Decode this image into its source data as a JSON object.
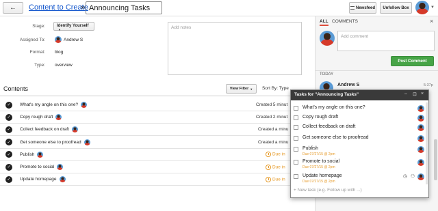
{
  "toolbar": {
    "back_glyph": "←",
    "breadcrumb": "Content to Create",
    "separator": "»",
    "title": "Announcing Tasks",
    "newsfeed_label": "Newsfeed",
    "unfollow_label": "Unfollow Box"
  },
  "meta": {
    "stage_label": "Stage:",
    "stage_value": "Identify Yourself",
    "assigned_label": "Assigned To:",
    "assigned_value": "Andrew S",
    "format_label": "Format:",
    "format_value": "blog",
    "type_label": "Type:",
    "type_value": "overview",
    "notes_placeholder": "Add notes"
  },
  "contents": {
    "title": "Contents",
    "view_filter": "View Filter",
    "sort_by": "Sort By: Type",
    "rows": [
      {
        "label": "What's my angle on this one?",
        "status": "Created 5 minut",
        "due": false
      },
      {
        "label": "Copy rough draft",
        "status": "Created 2 minut",
        "due": false
      },
      {
        "label": "Collect feedback on draft",
        "status": "Created a minu",
        "due": false
      },
      {
        "label": "Get someone else to proofread",
        "status": "Created a minu",
        "due": false
      },
      {
        "label": "Publish",
        "status": "Due in",
        "due": true
      },
      {
        "label": "Promote to social",
        "status": "Due in",
        "due": true
      },
      {
        "label": "Update homepage",
        "status": "Due in",
        "due": true
      }
    ]
  },
  "side": {
    "tab_all": "ALL",
    "tab_comments": "COMMENTS",
    "close_glyph": "×",
    "comment_placeholder": "Add comment",
    "post_button": "Post Comment",
    "today_label": "TODAY",
    "feed_name": "Andrew S",
    "feed_time": "5:37p"
  },
  "task_panel": {
    "title": "Tasks for \"Announcing Tasks\"",
    "controls": [
      "–",
      "⊡",
      "×"
    ],
    "tasks": [
      {
        "label": "What's my angle on this one?",
        "due": ""
      },
      {
        "label": "Copy rough draft",
        "due": ""
      },
      {
        "label": "Collect feedback on draft",
        "due": ""
      },
      {
        "label": "Get someone else to proofread",
        "due": ""
      },
      {
        "label": "Publish",
        "due": "Due 07/27/15 @ 2pm"
      },
      {
        "label": "Promote to social",
        "due": "Due 07/27/15 @ 2pm"
      },
      {
        "label": "Update homepage",
        "due": "Due 07/27/15 @ 2pm"
      }
    ],
    "new_task_placeholder": "New task (e.g. Follow up with ...)"
  },
  "colors": {
    "link": "#1155cc",
    "due_orange": "#e69b2a",
    "post_green": "#47a447",
    "panel_header": "#3a3a3a",
    "active_tab": "#dd4b39"
  }
}
